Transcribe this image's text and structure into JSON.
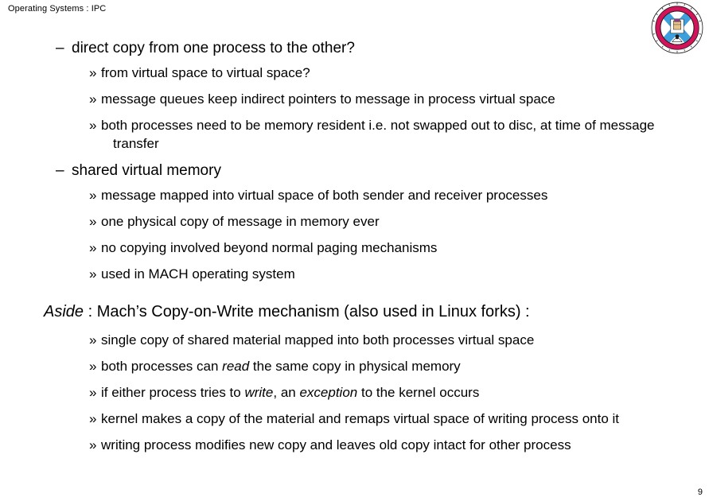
{
  "header": {
    "title": "Operating Systems : IPC"
  },
  "logo": {
    "name": "university-of-edinburgh-crest",
    "ring_text_top": "THE UNIVERSITY",
    "ring_text_bottom": "OF EDINBURGH",
    "colors": {
      "ring": "#D3145A",
      "saltire": "#3DA0DC",
      "field": "#FFFFFF",
      "outline": "#1A1A1A",
      "figure": "#E8C48A"
    }
  },
  "content": {
    "blocks": [
      {
        "level": 1,
        "marker": "–",
        "text": "direct copy from one process to the other?"
      },
      {
        "level": 2,
        "marker": "»",
        "text": "from virtual space to virtual space?"
      },
      {
        "level": 2,
        "marker": "»",
        "text": "message queues keep indirect pointers to message in process virtual space"
      },
      {
        "level": 2,
        "marker": "»",
        "text": "both processes need to be memory resident i.e. not swapped out to disc, at time of message transfer"
      },
      {
        "level": 1,
        "marker": "–",
        "text": "shared virtual memory"
      },
      {
        "level": 2,
        "marker": "»",
        "text": "message mapped into virtual space of both sender and receiver processes"
      },
      {
        "level": 2,
        "marker": "»",
        "text": "one physical copy of message in memory ever"
      },
      {
        "level": 2,
        "marker": "»",
        "text": "no copying involved beyond normal paging mechanisms"
      },
      {
        "level": 2,
        "marker": "»",
        "text": "used in MACH operating system"
      }
    ],
    "aside": {
      "emphasis": "Aside",
      "rest": " : Mach’s Copy-on-Write mechanism (also used in Linux forks) :"
    },
    "aside_blocks": [
      {
        "level": 2,
        "marker": "»",
        "pre": "single copy of shared material mapped into both processes virtual space",
        "ital": "",
        "post": ""
      },
      {
        "level": 2,
        "marker": "»",
        "pre": "both processes can ",
        "ital": "read",
        "post": " the same copy in physical memory"
      },
      {
        "level": 2,
        "marker": "»",
        "pre": "if either process tries to ",
        "ital": "write",
        "mid": ", an ",
        "ital2": "exception",
        "post": " to the kernel occurs"
      },
      {
        "level": 2,
        "marker": "»",
        "pre": "kernel makes a copy of the material and remaps virtual space of writing process onto it",
        "ital": "",
        "post": ""
      },
      {
        "level": 2,
        "marker": "»",
        "pre": "writing process modifies new copy and leaves old copy intact for other process",
        "ital": "",
        "post": ""
      }
    ]
  },
  "footer": {
    "page_number": "9"
  }
}
